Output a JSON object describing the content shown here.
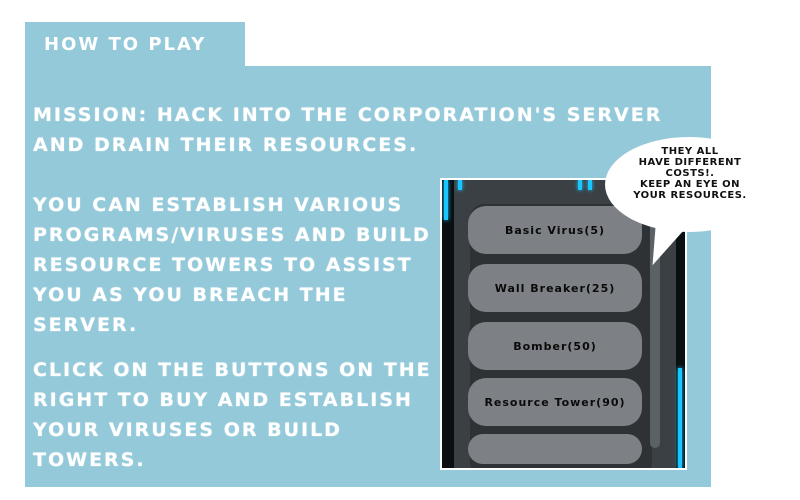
{
  "header": {
    "title": "HOW TO PLAY"
  },
  "instructions": {
    "mission": "MISSION: HACK INTO THE CORPORATION'S SERVER AND DRAIN THEIR RESOURCES.",
    "paragraph2": "YOU CAN ESTABLISH VARIOUS PROGRAMS/VIRUSES AND BUILD RESOURCE TOWERS TO ASSIST YOU AS YOU BREACH THE SERVER.",
    "paragraph3": "CLICK ON THE BUTTONS ON THE RIGHT TO BUY AND ESTABLISH YOUR VIRUSES OR BUILD TOWERS."
  },
  "shop": {
    "buttons": [
      {
        "label": "Basic Virus(5)"
      },
      {
        "label": "Wall Breaker(25)"
      },
      {
        "label": "Bomber(50)"
      },
      {
        "label": "Resource Tower(90)"
      }
    ]
  },
  "bubble": {
    "line1": "THEY ALL",
    "line2": "HAVE DIFFERENT",
    "line3": "COSTS!.",
    "line4": "KEEP AN EYE ON",
    "line5": "YOUR RESOURCES."
  },
  "colors": {
    "panel": "#94c9d9",
    "neon": "#19c6ff",
    "button": "#7d8185"
  }
}
